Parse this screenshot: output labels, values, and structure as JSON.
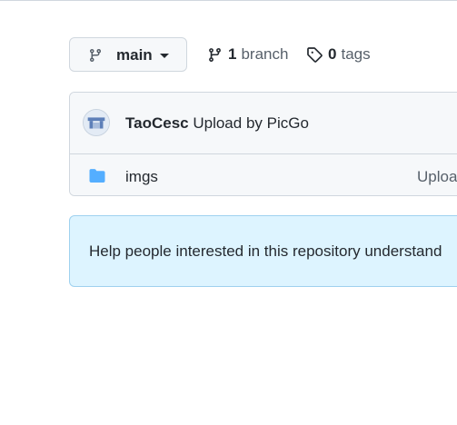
{
  "branch_selector": {
    "current_branch": "main"
  },
  "repo_meta": {
    "branch_count": "1",
    "branch_label": "branch",
    "tag_count": "0",
    "tag_label": "tags"
  },
  "latest_commit": {
    "author": "TaoCesc",
    "message": "Upload by PicGo"
  },
  "files": [
    {
      "type": "folder",
      "name": "imgs",
      "commit_message": "Uploa"
    }
  ],
  "readme_prompt": {
    "text": "Help people interested in this repository understand"
  },
  "colors": {
    "folder": "#54aeff",
    "accent_bg": "#ddf4ff",
    "border": "#d0d7de"
  }
}
